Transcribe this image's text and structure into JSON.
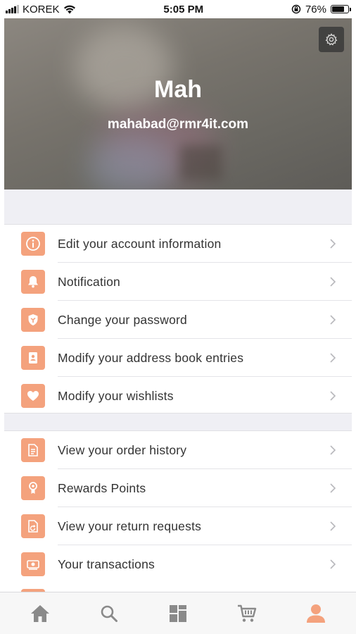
{
  "status_bar": {
    "carrier": "KOREK",
    "time": "5:05 PM",
    "battery": "76%",
    "battery_level": 0.76
  },
  "profile": {
    "name": "Mah",
    "email": "mahabad@rmr4it.com"
  },
  "accent_color": "#f4a27d",
  "account_menu": [
    {
      "label": "Edit your account information",
      "icon": "info-icon"
    },
    {
      "label": "Notification",
      "icon": "bell-icon"
    },
    {
      "label": "Change your password",
      "icon": "shield-icon"
    },
    {
      "label": "Modify your address book entries",
      "icon": "address-book-icon"
    },
    {
      "label": "Modify your wishlists",
      "icon": "heart-icon"
    }
  ],
  "orders_menu": [
    {
      "label": "View your order history",
      "icon": "order-history-icon"
    },
    {
      "label": "Rewards Points",
      "icon": "reward-icon"
    },
    {
      "label": "View your return requests",
      "icon": "return-request-icon"
    },
    {
      "label": "Your transactions",
      "icon": "transaction-icon"
    }
  ],
  "tab_bar": {
    "tabs": [
      {
        "name": "home",
        "icon": "home-icon",
        "active": false
      },
      {
        "name": "search",
        "icon": "search-icon",
        "active": false
      },
      {
        "name": "categories",
        "icon": "grid-icon",
        "active": false
      },
      {
        "name": "cart",
        "icon": "cart-icon",
        "active": false
      },
      {
        "name": "account",
        "icon": "user-icon",
        "active": true
      }
    ],
    "active_color": "#f4a27d",
    "inactive_color": "#8a8a8a"
  }
}
